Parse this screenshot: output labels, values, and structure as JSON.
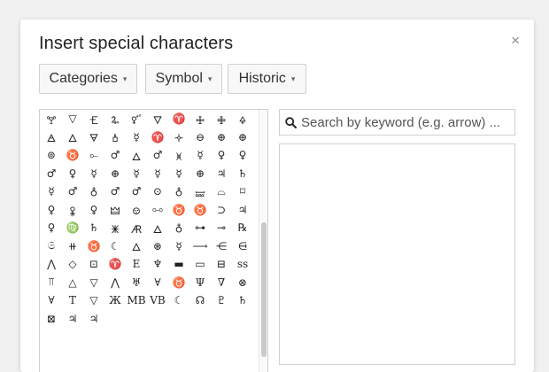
{
  "dialog": {
    "title": "Insert special characters",
    "close_label": "×"
  },
  "dropdowns": [
    {
      "label": "Categories",
      "caret": "▾"
    },
    {
      "label": "Symbol",
      "caret": "▾"
    },
    {
      "label": "Historic",
      "caret": "▾"
    }
  ],
  "search": {
    "placeholder": "Search by keyword (e.g. arrow) ...",
    "value": "",
    "icon": "search-icon"
  },
  "grid": {
    "rows": [
      [
        "🝖",
        "▽",
        "🝗",
        "🜩",
        "🜡",
        "🜄",
        "♈",
        "🜊",
        "🜋",
        "🜍"
      ],
      [
        "🜁",
        "🜂",
        "🜃",
        "🝅",
        "☿",
        "♈",
        "🝊",
        "⊖",
        "⊕",
        "⊕"
      ],
      [
        "⊚",
        "♉",
        "⟜",
        "♂",
        "🜂",
        "♂",
        "🝍",
        "☿",
        "♀",
        "♀"
      ],
      [
        "♂",
        "♀",
        "☿",
        "⊕",
        "☿",
        "☿",
        "☿",
        "⊕",
        "♃",
        "♄"
      ],
      [
        "☿",
        "♂",
        "♁",
        "♂",
        "♂",
        "⊙",
        "♁",
        "🝛",
        "⌓",
        "⌑"
      ],
      [
        "♀",
        "🜢",
        "♀",
        "🜲",
        "🝎",
        "⧟",
        "♉",
        "♉",
        "⊃",
        "♃"
      ],
      [
        "♀",
        "♍",
        "♄",
        "🜹",
        "🜇",
        "🜂",
        "♁",
        "⊶",
        "⊸",
        "℞"
      ],
      [
        "𝔖",
        "⧺",
        "♉",
        "☾",
        "🜂",
        "⊛",
        "☿",
        "⟶",
        "⋲",
        "⋳"
      ],
      [
        "⋀",
        "◇",
        "⊡",
        "♈",
        "E",
        "♆",
        "▬",
        "▭",
        "⊟",
        "ss"
      ],
      [
        "⫪",
        "△",
        "▽",
        "⋀",
        "♅",
        "∀",
        "♉",
        "Ψ",
        "∇",
        "⊗"
      ],
      [
        "∀",
        "T",
        "▽",
        "Ж",
        "MB",
        "VB",
        "☾",
        "☊",
        "♇",
        "♄"
      ],
      [
        "⊠",
        "♃",
        "♃"
      ]
    ]
  },
  "colors": {
    "background": "#f1f1f1",
    "dialog": "#ffffff",
    "border": "#cfcfcf",
    "text": "#222222"
  }
}
